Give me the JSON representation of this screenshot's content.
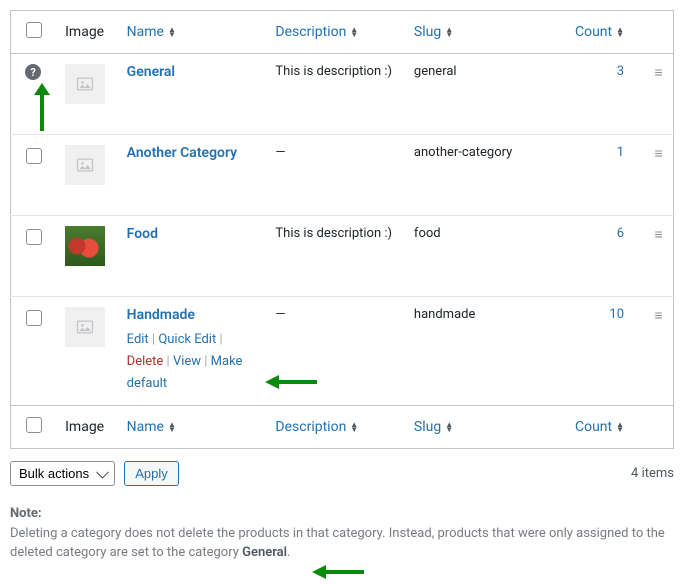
{
  "columns": {
    "image": "Image",
    "name": "Name",
    "description": "Description",
    "slug": "Slug",
    "count": "Count"
  },
  "rows": [
    {
      "help": "?",
      "name": "General",
      "description": "This is description :)",
      "slug": "general",
      "count": "3",
      "thumb": "placeholder"
    },
    {
      "name": "Another Category",
      "description": "—",
      "slug": "another-category",
      "count": "1",
      "thumb": "placeholder"
    },
    {
      "name": "Food",
      "description": "This is description :)",
      "slug": "food",
      "count": "6",
      "thumb": "image"
    },
    {
      "name": "Handmade",
      "description": "—",
      "slug": "handmade",
      "count": "10",
      "thumb": "placeholder",
      "actions": {
        "edit": "Edit",
        "quick_edit": "Quick Edit",
        "delete": "Delete",
        "view": "View",
        "make_default": "Make default"
      }
    }
  ],
  "bulk": {
    "label": "Bulk actions",
    "apply": "Apply"
  },
  "items_count": "4 items",
  "note": {
    "heading": "Note:",
    "text_before": "Deleting a category does not delete the products in that category. Instead, products that were only assigned to the deleted category are set to the category ",
    "default_cat": "General",
    "text_after": "."
  }
}
